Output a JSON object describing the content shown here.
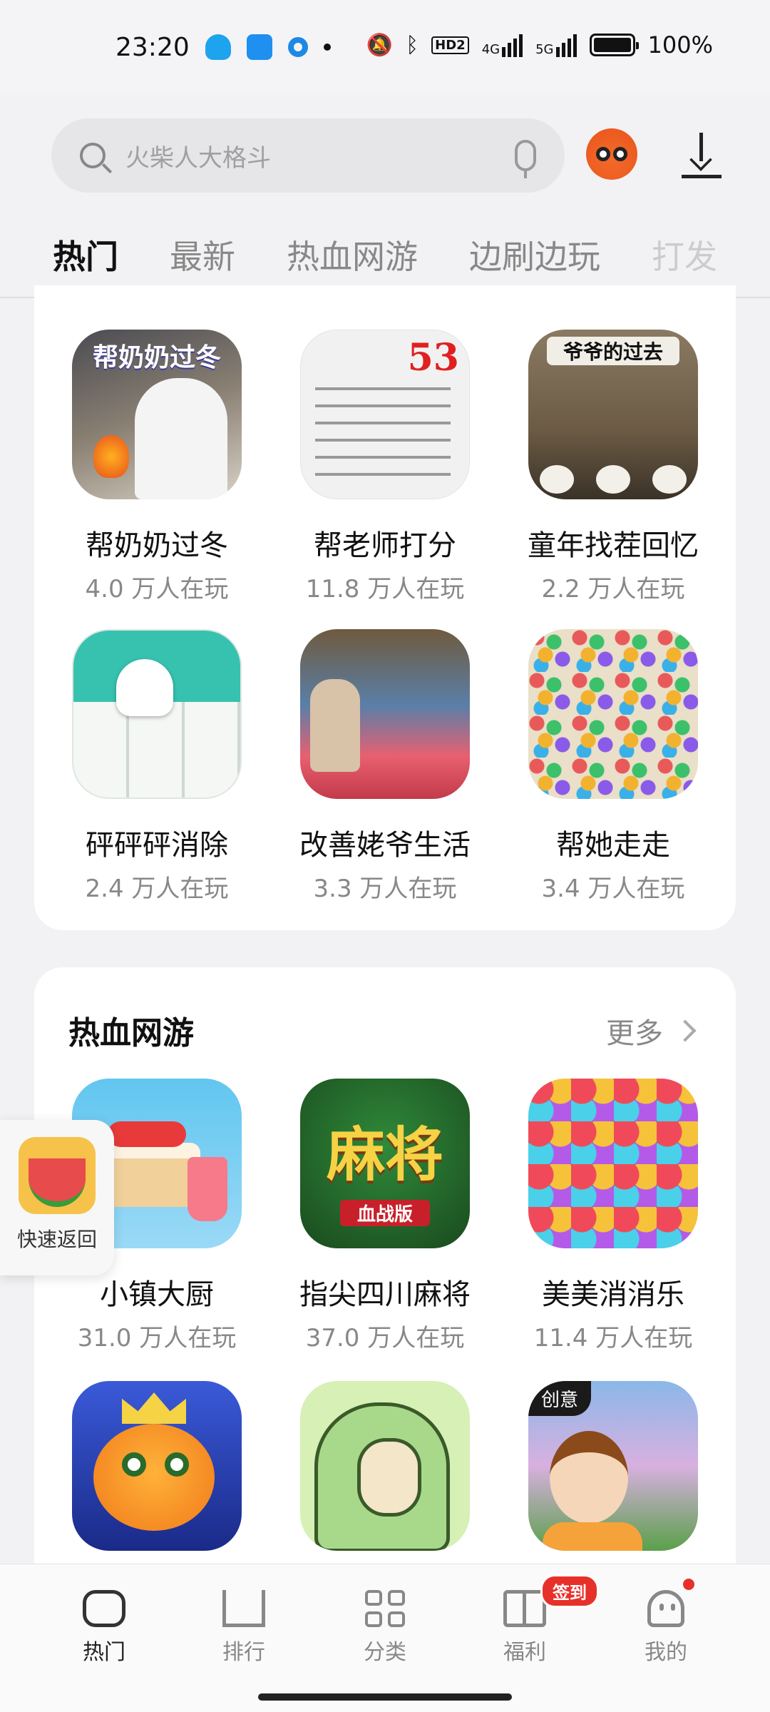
{
  "status_bar": {
    "time": "23:20",
    "badge_hd": "HD2",
    "net_4g": "4G",
    "net_5g": "5G",
    "battery_text": "100%"
  },
  "search": {
    "placeholder": "火柴人大格斗"
  },
  "tabs": [
    {
      "label": "热门",
      "active": true
    },
    {
      "label": "最新",
      "active": false
    },
    {
      "label": "热血网游",
      "active": false
    },
    {
      "label": "边刷边玩",
      "active": false
    },
    {
      "label": "打发",
      "active": false
    }
  ],
  "section1": {
    "games": [
      {
        "name": "帮奶奶过冬",
        "plays": "4.0 万人在玩",
        "icon_text": "帮奶奶过冬",
        "icon": "grandma-winter-icon"
      },
      {
        "name": "帮老师打分",
        "plays": "11.8 万人在玩",
        "icon_text": "53",
        "icon": "teacher-grade-icon"
      },
      {
        "name": "童年找茬回忆",
        "plays": "2.2 万人在玩",
        "icon_text": "爷爷的过去",
        "icon": "childhood-icon"
      },
      {
        "name": "砰砰砰消除",
        "plays": "2.4 万人在玩",
        "icon_text": "",
        "icon": "mahjong-tiles-icon"
      },
      {
        "name": "改善姥爷生活",
        "plays": "3.3 万人在玩",
        "icon_text": "",
        "icon": "grandpa-life-icon"
      },
      {
        "name": "帮她走走",
        "plays": "3.4 万人在玩",
        "icon_text": "",
        "icon": "jelly-beans-icon"
      }
    ]
  },
  "section2": {
    "title": "热血网游",
    "more": "更多",
    "games": [
      {
        "name": "小镇大厨",
        "plays": "31.0 万人在玩",
        "icon_text": "",
        "icon": "cake-icon"
      },
      {
        "name": "指尖四川麻将",
        "plays": "37.0 万人在玩",
        "icon_text": "麻将",
        "icon_sub": "血战版",
        "icon": "mahjong-icon"
      },
      {
        "name": "美美消消乐",
        "plays": "11.4 万人在玩",
        "icon_text": "",
        "icon": "candy-match-icon"
      },
      {
        "name": "",
        "plays": "",
        "icon_text": "",
        "icon": "fish-king-icon"
      },
      {
        "name": "",
        "plays": "",
        "icon_text": "",
        "icon": "green-dino-icon"
      },
      {
        "name": "",
        "plays": "",
        "icon_text": "创意",
        "icon": "girl-town-icon"
      }
    ]
  },
  "quick_back": {
    "label": "快速返回"
  },
  "bottom_nav": [
    {
      "label": "热门",
      "active": true
    },
    {
      "label": "排行",
      "active": false
    },
    {
      "label": "分类",
      "active": false
    },
    {
      "label": "福利",
      "active": false,
      "badge": "签到"
    },
    {
      "label": "我的",
      "active": false
    }
  ]
}
